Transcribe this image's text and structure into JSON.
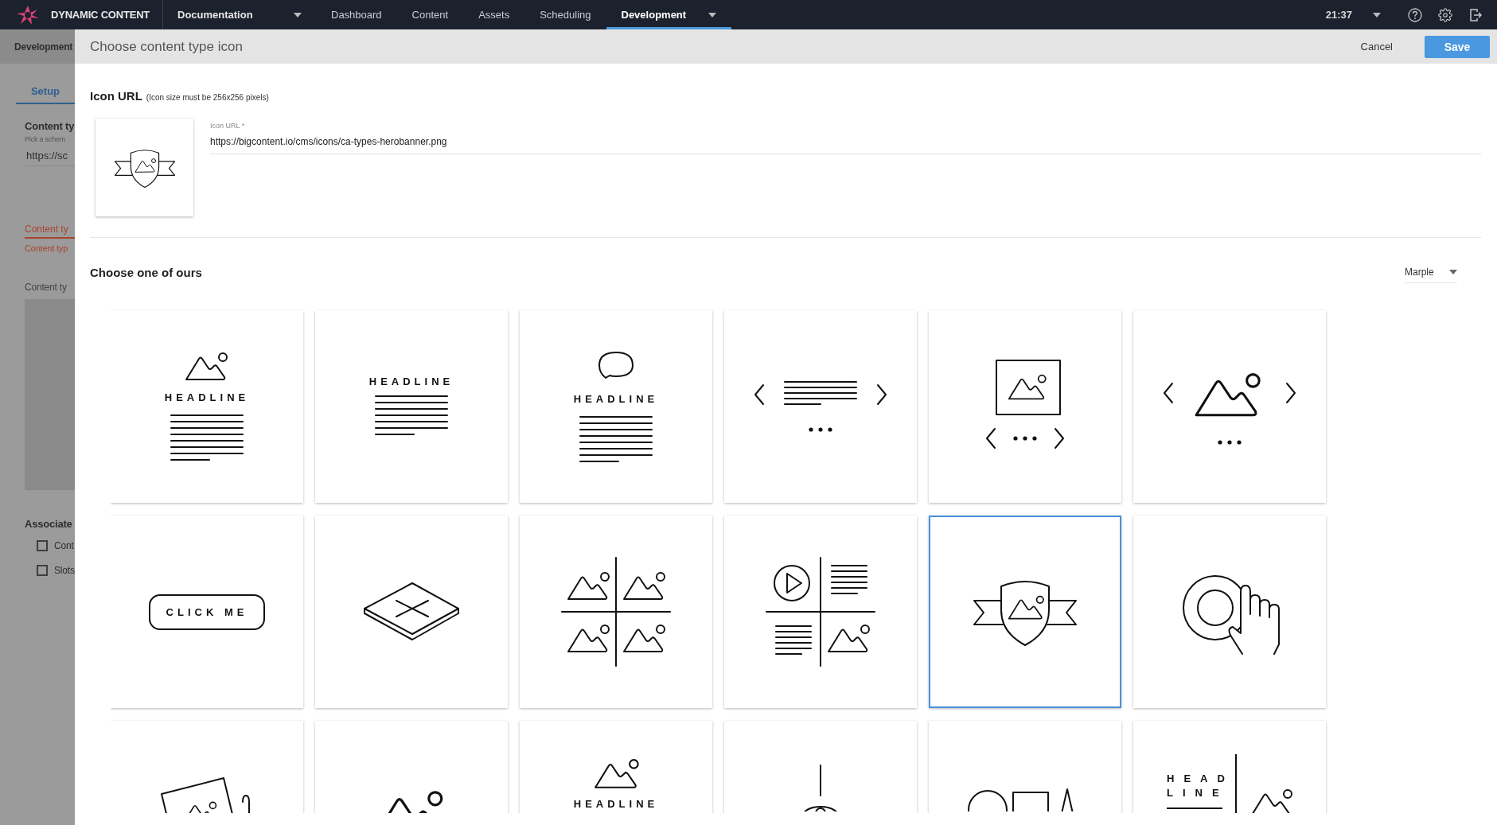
{
  "topbar": {
    "brand": "DYNAMIC CONTENT",
    "hub": "Documentation",
    "nav": [
      {
        "label": "Dashboard",
        "selected": false
      },
      {
        "label": "Content",
        "selected": false
      },
      {
        "label": "Assets",
        "selected": false
      },
      {
        "label": "Scheduling",
        "selected": false
      },
      {
        "label": "Development",
        "selected": true
      }
    ],
    "time": "21:37"
  },
  "background": {
    "breadcrumb": "Development",
    "tab": "Setup",
    "heading": "Content ty",
    "hint": "Pick a schem",
    "value": "https://sc",
    "error_field": "Content ty",
    "error_text": "Content typ",
    "preview_label": "Content ty",
    "section": "Associate",
    "checkboxes": [
      {
        "label": "Cont",
        "checked": false
      },
      {
        "label": "Slots",
        "checked": false
      }
    ]
  },
  "dialog": {
    "title": "Choose content type icon",
    "cancel": "Cancel",
    "save": "Save",
    "icon_url": {
      "heading": "Icon URL",
      "note": "(Icon size must be 256x256 pixels)",
      "label": "Icon URL *",
      "value": "https://bigcontent.io/cms/icons/ca-types-herobanner.png"
    },
    "gallery": {
      "heading": "Choose one of ours",
      "theme": "Marple",
      "tiles": [
        {
          "kind": "image-headline",
          "caption": "HEADLINE",
          "selected": false
        },
        {
          "kind": "headline-text",
          "caption": "HEADLINE",
          "selected": false
        },
        {
          "kind": "speech-headline",
          "caption": "HEADLINE",
          "selected": false
        },
        {
          "kind": "text-carousel",
          "selected": false
        },
        {
          "kind": "image-carousel",
          "selected": false
        },
        {
          "kind": "slider",
          "selected": false
        },
        {
          "kind": "button",
          "caption": "CLICK ME",
          "selected": false
        },
        {
          "kind": "placeholder",
          "selected": false
        },
        {
          "kind": "image-grid",
          "selected": false
        },
        {
          "kind": "video-grid",
          "selected": false
        },
        {
          "kind": "hero-banner",
          "selected": true
        },
        {
          "kind": "target-click",
          "selected": false
        },
        {
          "kind": "tilted-photo",
          "selected": false
        },
        {
          "kind": "mountains",
          "selected": false
        },
        {
          "kind": "image-caption",
          "caption": "HEADLINE",
          "selected": false
        },
        {
          "kind": "pendant",
          "selected": false
        },
        {
          "kind": "shapes",
          "selected": false
        },
        {
          "kind": "headline-split",
          "caption": "HEAD LINE",
          "selected": false
        }
      ]
    }
  }
}
